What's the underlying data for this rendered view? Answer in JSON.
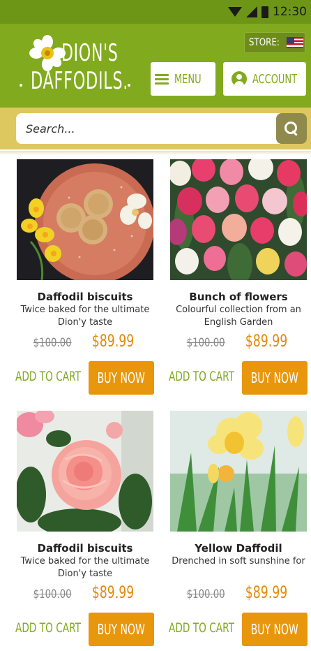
{
  "status_bar": {
    "time": "12:30",
    "icons": [
      "wifi-icon",
      "signal-icon",
      "battery-icon"
    ]
  },
  "header": {
    "logo_line1": "DION'S",
    "logo_line2": "DAFFODILS.",
    "store_label": "STORE:",
    "store_flag": "us-flag-icon",
    "menu_label": "MENU",
    "account_label": "ACCOUNT"
  },
  "search": {
    "placeholder": "Search..."
  },
  "colors": {
    "header_green": "#82aa1e",
    "status_green": "#6e9616",
    "search_band": "#ddc860",
    "buy_orange": "#e8960c",
    "price_orange": "#e28a0e"
  },
  "products": [
    {
      "name": "Daffodil biscuits",
      "desc": "Twice baked for the ultimate Dion'y taste",
      "old_price": "$100.00",
      "new_price": "$89.99",
      "add_to_cart": "ADD TO CART",
      "buy_now": "BUY NOW",
      "image": "biscuits-photo"
    },
    {
      "name": "Bunch of flowers",
      "desc": "Colourful collection from an English Garden",
      "old_price": "$100.00",
      "new_price": "$89.99",
      "add_to_cart": "ADD TO CART",
      "buy_now": "BUY NOW",
      "image": "tulips-photo"
    },
    {
      "name": "Daffodil biscuits",
      "desc": "Twice baked for the ultimate Dion'y taste",
      "old_price": "$100.00",
      "new_price": "$89.99",
      "add_to_cart": "ADD TO CART",
      "buy_now": "BUY NOW",
      "image": "rose-photo"
    },
    {
      "name": "Yellow Daffodil",
      "desc": "Drenched in soft sunshine for",
      "old_price": "$100.00",
      "new_price": "$89.99",
      "add_to_cart": "ADD TO CART",
      "buy_now": "BUY NOW",
      "image": "daffodil-photo"
    }
  ]
}
